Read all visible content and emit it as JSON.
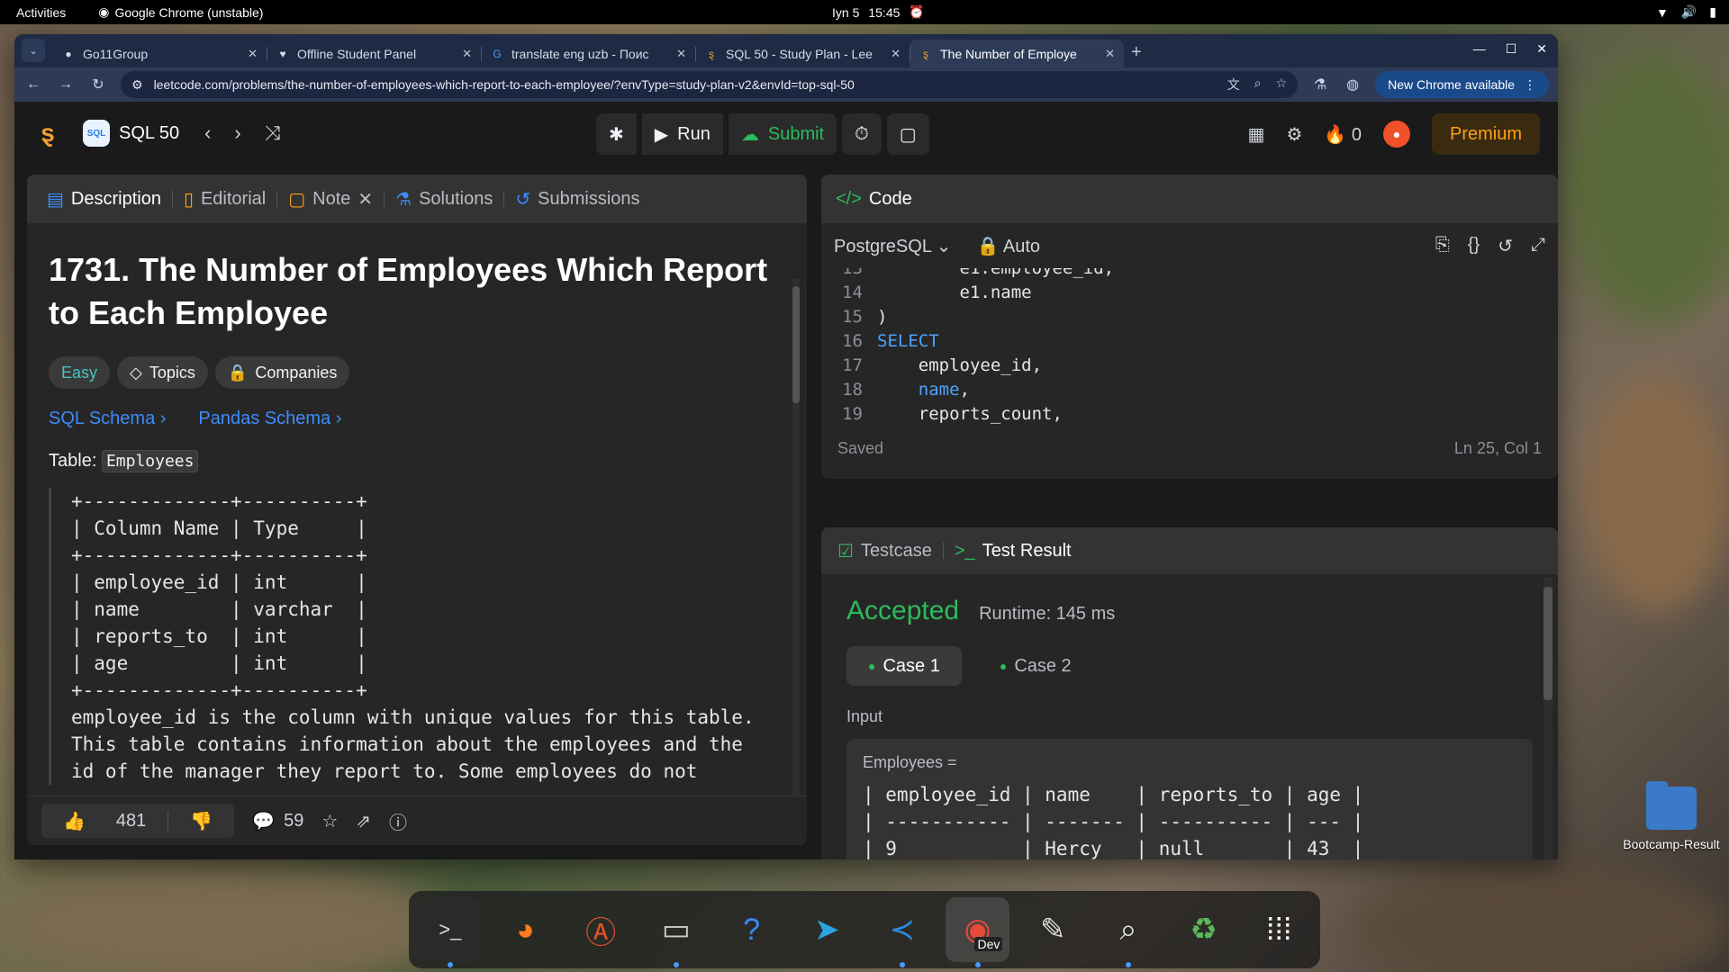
{
  "topbar": {
    "activities": "Activities",
    "app_name": "Google Chrome (unstable)",
    "date": "Iyn 5",
    "time": "15:45"
  },
  "browser": {
    "tabs": [
      {
        "label": "Go11Group",
        "icon": "github-icon"
      },
      {
        "label": "Offline Student Panel",
        "icon": "heart-icon"
      },
      {
        "label": "translate eng uzb - Поис",
        "icon": "google-icon"
      },
      {
        "label": "SQL 50 - Study Plan - Lee",
        "icon": "leetcode-icon"
      },
      {
        "label": "The Number of Employe",
        "icon": "leetcode-icon"
      }
    ],
    "url": "leetcode.com/problems/the-number-of-employees-which-report-to-each-employee/?envType=study-plan-v2&envId=top-sql-50",
    "new_chrome": "New Chrome available"
  },
  "lc_header": {
    "list_badge": "SQL",
    "list_name": "SQL 50",
    "run": "Run",
    "submit": "Submit",
    "streak": "0",
    "premium": "Premium"
  },
  "left": {
    "tabs": [
      "Description",
      "Editorial",
      "Note",
      "Solutions",
      "Submissions"
    ],
    "title": "1731. The Number of Employees Which Report to Each Employee",
    "chips": [
      "Easy",
      "Topics",
      "Companies"
    ],
    "schemas": [
      "SQL Schema",
      "Pandas Schema"
    ],
    "table_prefix": "Table:",
    "table_name": "Employees",
    "schema_text": "+-------------+----------+\n| Column Name | Type     |\n+-------------+----------+\n| employee_id | int      |\n| name        | varchar  |\n| reports_to  | int      |\n| age         | int      |\n+-------------+----------+\nemployee_id is the column with unique values for this table.\nThis table contains information about the employees and the\nid of the manager they report to. Some employees do not",
    "likes": "481",
    "comments": "59"
  },
  "code": {
    "header": "Code",
    "language": "PostgreSQL",
    "mode": "Auto",
    "lines": [
      {
        "n": "13",
        "text": "        e1.employee_id,",
        "kw": false
      },
      {
        "n": "14",
        "text": "        e1.name",
        "kw": false
      },
      {
        "n": "15",
        "text": ")",
        "kw": false
      },
      {
        "n": "16",
        "text": "SELECT",
        "kw": true
      },
      {
        "n": "17",
        "text": "    employee_id,",
        "kw": false
      },
      {
        "n": "18",
        "text": "    name,",
        "kw": "name"
      },
      {
        "n": "19",
        "text": "    reports_count,",
        "kw": false
      }
    ],
    "saved": "Saved",
    "cursor": "Ln 25, Col 1"
  },
  "test": {
    "tabs": [
      "Testcase",
      "Test Result"
    ],
    "status": "Accepted",
    "runtime": "Runtime: 145 ms",
    "cases": [
      "Case 1",
      "Case 2"
    ],
    "input_label": "Input",
    "var_name": "Employees =",
    "table_text": "| employee_id | name    | reports_to | age |\n| ----------- | ------- | ---------- | --- |\n| 9           | Hercy   | null       | 43  |"
  },
  "desktop": {
    "folder_label": "Bootcamp-Result"
  },
  "dock": {
    "chrome_badge": "Dev",
    "apps": [
      "terminal-icon",
      "firefox-icon",
      "app-center-icon",
      "files-icon",
      "help-icon",
      "telegram-icon",
      "vscode-icon",
      "chrome-dev-icon",
      "text-editor-icon",
      "image-viewer-icon",
      "trash-icon",
      "app-grid-icon"
    ]
  }
}
